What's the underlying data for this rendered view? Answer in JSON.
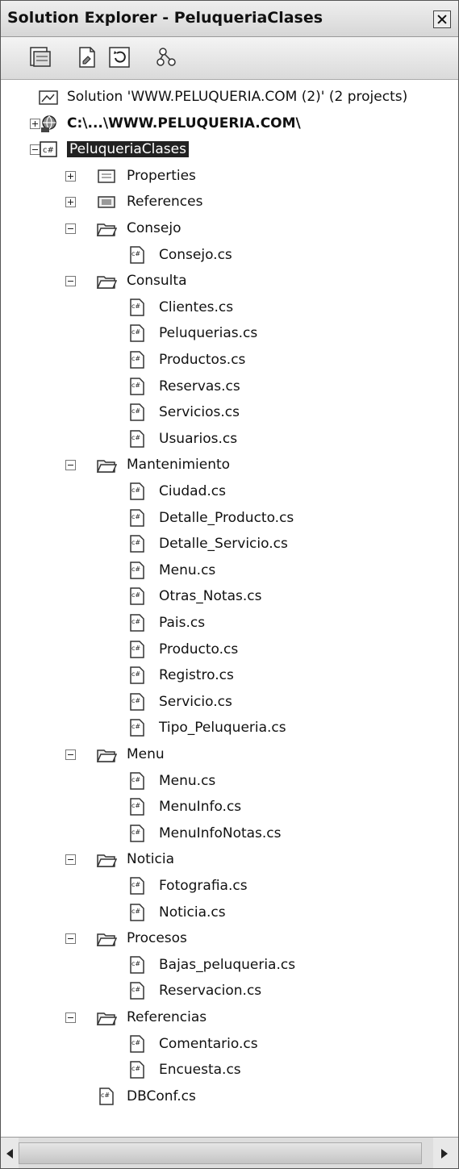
{
  "window": {
    "title": "Solution Explorer - PeluqueriaClases"
  },
  "toolbar": {
    "buttons": [
      "show-all-files",
      "properties",
      "refresh",
      "view-class-diagram"
    ]
  },
  "tree": [
    {
      "label": "Solution 'WWW.PELUQUERIA.COM (2)' (2 projects)",
      "level": 0,
      "icon": "solution-icon",
      "toggle": "none"
    },
    {
      "label": "C:\\...\\WWW.PELUQUERIA.COM\\",
      "level": 0,
      "icon": "website-icon",
      "toggle": "plus",
      "bold": true
    },
    {
      "label": "PeluqueriaClases",
      "level": 0,
      "icon": "csharp-project-icon",
      "toggle": "minus",
      "selected": true
    },
    {
      "label": "Properties",
      "level": 1,
      "icon": "properties-icon",
      "toggle": "plus"
    },
    {
      "label": "References",
      "level": 1,
      "icon": "references-icon",
      "toggle": "plus"
    },
    {
      "label": "Consejo",
      "level": 1,
      "icon": "folder-icon",
      "toggle": "minus"
    },
    {
      "label": "Consejo.cs",
      "level": 2,
      "icon": "cs-file-icon",
      "toggle": "none"
    },
    {
      "label": "Consulta",
      "level": 1,
      "icon": "folder-icon",
      "toggle": "minus"
    },
    {
      "label": "Clientes.cs",
      "level": 2,
      "icon": "cs-file-icon",
      "toggle": "none"
    },
    {
      "label": "Peluquerias.cs",
      "level": 2,
      "icon": "cs-file-icon",
      "toggle": "none"
    },
    {
      "label": "Productos.cs",
      "level": 2,
      "icon": "cs-file-icon",
      "toggle": "none"
    },
    {
      "label": "Reservas.cs",
      "level": 2,
      "icon": "cs-file-icon",
      "toggle": "none"
    },
    {
      "label": "Servicios.cs",
      "level": 2,
      "icon": "cs-file-icon",
      "toggle": "none"
    },
    {
      "label": "Usuarios.cs",
      "level": 2,
      "icon": "cs-file-icon",
      "toggle": "none"
    },
    {
      "label": "Mantenimiento",
      "level": 1,
      "icon": "folder-icon",
      "toggle": "minus"
    },
    {
      "label": "Ciudad.cs",
      "level": 2,
      "icon": "cs-file-icon",
      "toggle": "none"
    },
    {
      "label": "Detalle_Producto.cs",
      "level": 2,
      "icon": "cs-file-icon",
      "toggle": "none"
    },
    {
      "label": "Detalle_Servicio.cs",
      "level": 2,
      "icon": "cs-file-icon",
      "toggle": "none"
    },
    {
      "label": "Menu.cs",
      "level": 2,
      "icon": "cs-file-icon",
      "toggle": "none"
    },
    {
      "label": "Otras_Notas.cs",
      "level": 2,
      "icon": "cs-file-icon",
      "toggle": "none"
    },
    {
      "label": "Pais.cs",
      "level": 2,
      "icon": "cs-file-icon",
      "toggle": "none"
    },
    {
      "label": "Producto.cs",
      "level": 2,
      "icon": "cs-file-icon",
      "toggle": "none"
    },
    {
      "label": "Registro.cs",
      "level": 2,
      "icon": "cs-file-icon",
      "toggle": "none"
    },
    {
      "label": "Servicio.cs",
      "level": 2,
      "icon": "cs-file-icon",
      "toggle": "none"
    },
    {
      "label": "Tipo_Peluqueria.cs",
      "level": 2,
      "icon": "cs-file-icon",
      "toggle": "none"
    },
    {
      "label": "Menu",
      "level": 1,
      "icon": "folder-icon",
      "toggle": "minus"
    },
    {
      "label": "Menu.cs",
      "level": 2,
      "icon": "cs-file-icon",
      "toggle": "none"
    },
    {
      "label": "MenuInfo.cs",
      "level": 2,
      "icon": "cs-file-icon",
      "toggle": "none"
    },
    {
      "label": "MenuInfoNotas.cs",
      "level": 2,
      "icon": "cs-file-icon",
      "toggle": "none"
    },
    {
      "label": "Noticia",
      "level": 1,
      "icon": "folder-icon",
      "toggle": "minus"
    },
    {
      "label": "Fotografia.cs",
      "level": 2,
      "icon": "cs-file-icon",
      "toggle": "none"
    },
    {
      "label": "Noticia.cs",
      "level": 2,
      "icon": "cs-file-icon",
      "toggle": "none"
    },
    {
      "label": "Procesos",
      "level": 1,
      "icon": "folder-icon",
      "toggle": "minus"
    },
    {
      "label": "Bajas_peluqueria.cs",
      "level": 2,
      "icon": "cs-file-icon",
      "toggle": "none"
    },
    {
      "label": "Reservacion.cs",
      "level": 2,
      "icon": "cs-file-icon",
      "toggle": "none"
    },
    {
      "label": "Referencias",
      "level": 1,
      "icon": "folder-icon",
      "toggle": "minus"
    },
    {
      "label": "Comentario.cs",
      "level": 2,
      "icon": "cs-file-icon",
      "toggle": "none"
    },
    {
      "label": "Encuesta.cs",
      "level": 2,
      "icon": "cs-file-icon",
      "toggle": "none"
    },
    {
      "label": "DBConf.cs",
      "level": 1,
      "icon": "cs-file-icon",
      "toggle": "none"
    }
  ]
}
